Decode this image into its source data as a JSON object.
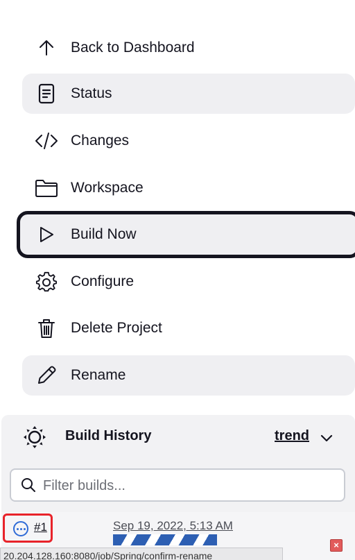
{
  "sidebar": {
    "items": [
      {
        "label": "Back to Dashboard",
        "icon": "arrow-up-icon"
      },
      {
        "label": "Status",
        "icon": "document-icon"
      },
      {
        "label": "Changes",
        "icon": "code-icon"
      },
      {
        "label": "Workspace",
        "icon": "folder-icon"
      },
      {
        "label": "Build Now",
        "icon": "play-icon"
      },
      {
        "label": "Configure",
        "icon": "gear-icon"
      },
      {
        "label": "Delete Project",
        "icon": "trash-icon"
      },
      {
        "label": "Rename",
        "icon": "pencil-icon"
      }
    ]
  },
  "build_history": {
    "title": "Build History",
    "trend_label": "trend",
    "filter_placeholder": "Filter builds...",
    "builds": [
      {
        "number": "#1",
        "date": "Sep 19, 2022, 5:13 AM",
        "status": "in-progress"
      }
    ]
  },
  "statusbar": {
    "url": "20.204.128.160:8080/job/Spring/confirm-rename"
  },
  "colors": {
    "accent": "#2d5fb3",
    "highlight_border": "#14141f",
    "annotation_red": "#e8232a"
  }
}
